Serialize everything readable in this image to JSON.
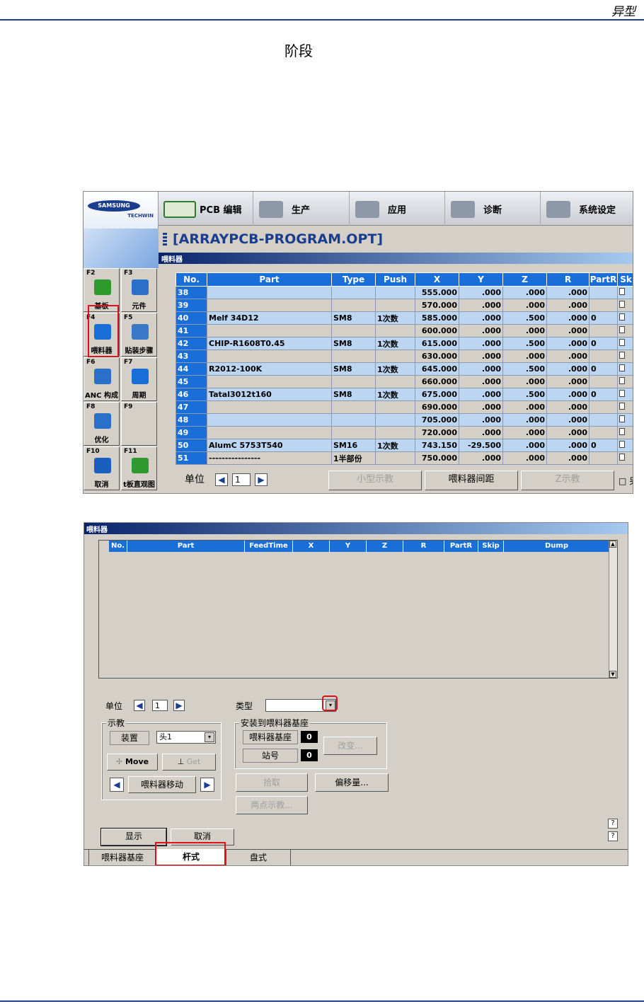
{
  "header": {
    "label": "异型"
  },
  "stage": "阶段",
  "shot1": {
    "logo": {
      "brand": "SAMSUNG",
      "sub": "TECHWIN"
    },
    "menu": [
      {
        "label": "PCB 编辑",
        "icon": "pcb-edit-icon"
      },
      {
        "label": "生产",
        "icon": "production-icon"
      },
      {
        "label": "应用",
        "icon": "application-icon"
      },
      {
        "label": "诊断",
        "icon": "diagnosis-icon"
      },
      {
        "label": "系统设定",
        "icon": "system-settings-icon"
      }
    ],
    "title": "[ARRAYPCB-PROGRAM.OPT]",
    "caption": "喂料器",
    "fkeys": [
      {
        "num": "F2",
        "label": "基板",
        "color": "#2e9a2e"
      },
      {
        "num": "F3",
        "label": "元件",
        "color": "#2a6fc8"
      },
      {
        "num": "F4",
        "label": "喂料器",
        "color": "#1a6ed8"
      },
      {
        "num": "F5",
        "label": "贴装步骤",
        "color": "#3a78c8"
      },
      {
        "num": "F6",
        "label": "ANC 构成",
        "color": "#2a6fc8"
      },
      {
        "num": "F7",
        "label": "周期",
        "color": "#1a6ed8"
      },
      {
        "num": "F8",
        "label": "优化",
        "color": "#2a6fc8"
      },
      {
        "num": "F9",
        "label": "",
        "color": ""
      },
      {
        "num": "F10",
        "label": "取消",
        "color": "#1a5fc0"
      },
      {
        "num": "F11",
        "label": "t板直观图",
        "color": "#2e9a2e"
      }
    ],
    "table": {
      "headers": [
        "No.",
        "Part",
        "Type",
        "Push",
        "X",
        "Y",
        "Z",
        "R",
        "PartR",
        "Sk"
      ],
      "rows": [
        [
          "38",
          "",
          "",
          "",
          "555.000",
          ".000",
          ".000",
          ".000",
          ""
        ],
        [
          "39",
          "",
          "",
          "",
          "570.000",
          ".000",
          ".000",
          ".000",
          ""
        ],
        [
          "40",
          "Melf 34D12",
          "SM8",
          "1次数",
          "585.000",
          ".000",
          ".500",
          ".000",
          "0"
        ],
        [
          "41",
          "",
          "",
          "",
          "600.000",
          ".000",
          ".000",
          ".000",
          ""
        ],
        [
          "42",
          "CHIP-R1608T0.45",
          "SM8",
          "1次数",
          "615.000",
          ".000",
          ".500",
          ".000",
          "0"
        ],
        [
          "43",
          "",
          "",
          "",
          "630.000",
          ".000",
          ".000",
          ".000",
          ""
        ],
        [
          "44",
          "R2012-100K",
          "SM8",
          "1次数",
          "645.000",
          ".000",
          ".500",
          ".000",
          "0"
        ],
        [
          "45",
          "",
          "",
          "",
          "660.000",
          ".000",
          ".000",
          ".000",
          ""
        ],
        [
          "46",
          "Tatal3012t160",
          "SM8",
          "1次数",
          "675.000",
          ".000",
          ".500",
          ".000",
          "0"
        ],
        [
          "47",
          "",
          "",
          "",
          "690.000",
          ".000",
          ".000",
          ".000",
          ""
        ],
        [
          "48",
          "",
          "",
          "",
          "705.000",
          ".000",
          ".000",
          ".000",
          ""
        ],
        [
          "49",
          "",
          "",
          "",
          "720.000",
          ".000",
          ".000",
          ".000",
          ""
        ],
        [
          "50",
          "AlumC 5753T540",
          "SM16",
          "1次数",
          "743.150",
          "-29.500",
          ".000",
          ".000",
          "0"
        ],
        [
          "51",
          "----------------",
          "1半部份",
          "",
          "750.000",
          ".000",
          ".000",
          ".000",
          ""
        ]
      ]
    },
    "bottom": {
      "unit_label": "单位",
      "unit_value": "1",
      "small_teach": "小型示教",
      "feeder_pitch": "喂料器间距",
      "z_teach": "Z示教",
      "cut": "另"
    }
  },
  "shot2": {
    "caption": "喂料器",
    "list_headers": [
      "No.",
      "Part",
      "FeedTime",
      "X",
      "Y",
      "Z",
      "R",
      "PartR",
      "Skip",
      "Dump"
    ],
    "unit_label": "单位",
    "unit_value": "1",
    "type_label": "类型",
    "type_value": "",
    "teach_group": "示教",
    "device_label": "装置",
    "device_value": "头1",
    "move": "Move",
    "get": "Get",
    "feeder_move": "喂料器移动",
    "install_group": "安装到喂料器基座",
    "base_label": "喂料器基座",
    "base_value": "0",
    "station_label": "站号",
    "station_value": "0",
    "change": "改变...",
    "pick": "拾取",
    "offset": "偏移量...",
    "two_point": "两点示教...",
    "show": "显示",
    "cancel": "取消",
    "help": "?",
    "tabs": [
      "喂料器基座",
      "杆式",
      "盘式"
    ]
  }
}
